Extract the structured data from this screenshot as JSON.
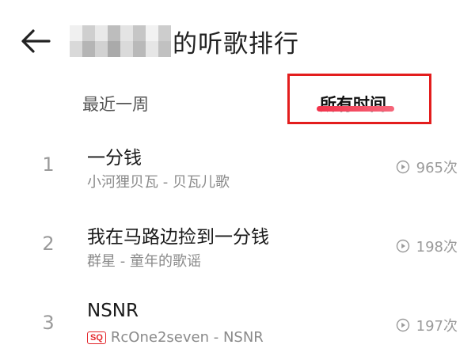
{
  "header": {
    "title_suffix": "的听歌排行",
    "back_icon": "arrow-left-icon"
  },
  "tabs": [
    {
      "label": "最近一周",
      "active": false
    },
    {
      "label": "所有时间",
      "active": true
    }
  ],
  "colors": {
    "accent": "#f2324a",
    "highlight_box": "#e31d1d",
    "sq_badge": "#e3262b"
  },
  "songs": [
    {
      "rank": "1",
      "title": "一分钱",
      "subtitle": "小河狸贝瓦 - 贝瓦儿歌",
      "badge": "",
      "plays": "965次"
    },
    {
      "rank": "2",
      "title": "我在马路边捡到一分钱",
      "subtitle": "群星 - 童年的歌谣",
      "badge": "",
      "plays": "198次"
    },
    {
      "rank": "3",
      "title": "NSNR",
      "subtitle": "RcOne2seven - NSNR",
      "badge": "SQ",
      "plays": "197次"
    }
  ]
}
